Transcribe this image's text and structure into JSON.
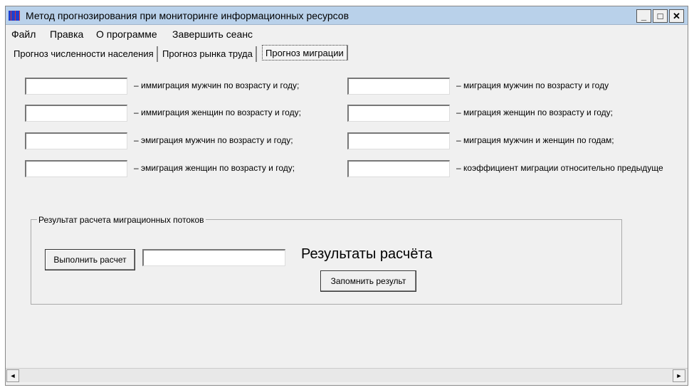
{
  "window": {
    "title": "Метод прогнозирования при мониторинге информационных ресурсов",
    "minimize": "_",
    "maximize": "□",
    "close": "✕"
  },
  "menu": [
    "Файл",
    "Правка",
    "О программе",
    "Завершить сеанс"
  ],
  "tabs": [
    "Прогноз численности населения",
    "Прогноз рынка труда",
    "Прогноз миграции"
  ],
  "left_fields": [
    {
      "label": "– иммиграция мужчин по возрасту и году;",
      "value": ""
    },
    {
      "label": "– иммиграция женщин по возрасту и году;",
      "value": ""
    },
    {
      "label": "– эмиграция мужчин по возрасту и году;",
      "value": ""
    },
    {
      "label": "– эмиграция женщин по возрасту и году;",
      "value": ""
    }
  ],
  "right_fields": [
    {
      "label": "– миграция мужчин по возрасту и году",
      "value": ""
    },
    {
      "label": "– миграция женщин по возрасту и году;",
      "value": ""
    },
    {
      "label": "– миграция мужчин и женщин по годам;",
      "value": ""
    },
    {
      "label": "– коэффициент миграции относительно предыдуще",
      "value": ""
    }
  ],
  "group": {
    "title": "Результат расчета миграционных потоков",
    "run_button": "Выполнить расчет",
    "result_value": "",
    "result_heading": "Результаты расчёта",
    "save_button": "Запомнить результ"
  },
  "scrollbar": {
    "left": "◄",
    "right": "►"
  }
}
